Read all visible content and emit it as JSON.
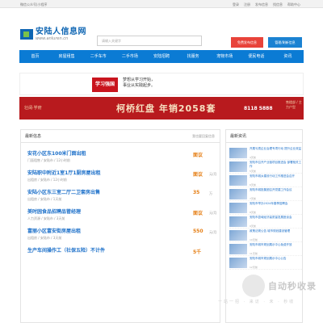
{
  "topbar": {
    "left_text": "微信公众号|小程序",
    "right_links": [
      "登录",
      "注册",
      "发布信息",
      "找信息",
      "帮助中心"
    ]
  },
  "header": {
    "logo_cn": "安陆人信息网",
    "logo_en": "www.anluren.cn",
    "search_placeholder": "请输入关键字",
    "btn_post_free": "免费发布信息",
    "btn_manage": "管理/刷新信息"
  },
  "nav": {
    "items": [
      "首页",
      "房屋租售",
      "二手车市",
      "二手市场",
      "安陆招聘",
      "找服务",
      "宠物市场",
      "便民电话",
      "资讯"
    ]
  },
  "banner1": {
    "brand": "学习强国",
    "slogan_line1": "梦想从学习开始，",
    "slogan_line2": "事业从实践起步。"
  },
  "banner2": {
    "left_text": "壮阔·学府",
    "main_text": "柯桥红盘 年销2058套",
    "phone": "8118 5888",
    "right_text": "售楼部 / 主力户型"
  },
  "main": {
    "title": "最新信息",
    "more": "我也要回复信息",
    "items": [
      {
        "title": "安花小区东100米门面出租",
        "meta": "门面租售 / 安陆市 / 12小时前",
        "price": "面议",
        "unit": ""
      },
      {
        "title": "安陆职中附近1室1厅1厨房屋出租",
        "meta": "出租房 / 安陆市 / 12小时前",
        "price": "面议",
        "unit": "元/月"
      },
      {
        "title": "安陆小区东三室二厅二卫套房出售",
        "meta": "出租房 / 安陆市 / 1天前",
        "price": "35",
        "unit": "万"
      },
      {
        "title": "美时园食品招聘品管经理",
        "meta": "人力资源 / 安陆市 / 3天前",
        "price": "面议",
        "unit": "元/月"
      },
      {
        "title": "富丽小区富安街房屋出租",
        "meta": "出租房 / 安陆市 / 3天前",
        "price": "550",
        "unit": "元/月"
      },
      {
        "title": "生产车间操作工（社保五险）不计件",
        "meta": "",
        "price": "5千",
        "unit": ""
      }
    ]
  },
  "side": {
    "title": "最新资讯",
    "items": [
      {
        "text": "开展亏损企业治理专项行动 提升企业效益",
        "date": "4天前"
      },
      {
        "text": "安陆市召开产业链项目推进会 部署相关工作",
        "date": "5天前"
      },
      {
        "text": "安陆市城乡建设行动工作推进会召开",
        "date": "6天前"
      },
      {
        "text": "安陆市城投集团召开党建工作会议",
        "date": "7天前"
      },
      {
        "text": "安陆市举办2024年春季招聘会",
        "date": "8天前"
      },
      {
        "text": "安陆市县域经济高质量发展座谈会",
        "date": "9天前"
      },
      {
        "text": "政策法规公告 城市规划建设管理",
        "date": "10天前"
      },
      {
        "text": "安陆市城市规划展示中心免费开放",
        "date": "11天前"
      },
      {
        "text": "安陆市城市规划展示中心公告",
        "date": "12天前"
      }
    ]
  },
  "watermark": {
    "text": "自动秒收录",
    "sub": "一站一招 · 来访 · 未 · 秒收"
  }
}
